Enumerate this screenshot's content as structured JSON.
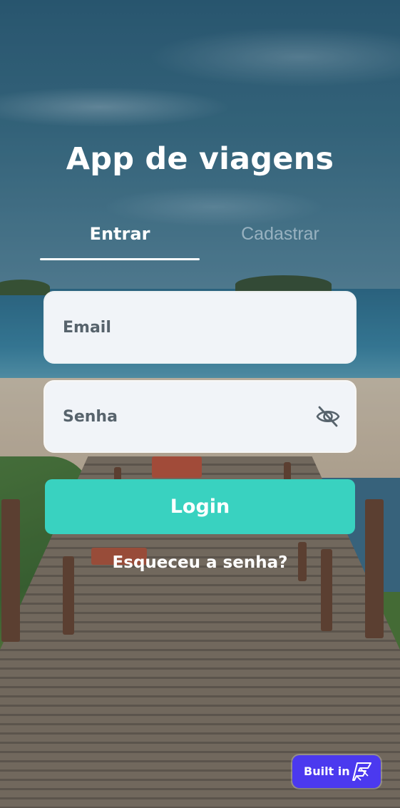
{
  "app": {
    "title": "App de viagens"
  },
  "tabs": [
    {
      "label": "Entrar",
      "active": true
    },
    {
      "label": "Cadastrar",
      "active": false
    }
  ],
  "form": {
    "email_placeholder": "Email",
    "email_value": "",
    "password_placeholder": "Senha",
    "password_value": "",
    "password_toggle_icon": "eye-off-icon",
    "login_label": "Login",
    "forgot_label": "Esqueceu a senha?"
  },
  "badge": {
    "label": "Built in",
    "icon": "flutterflow-icon"
  },
  "colors": {
    "accent": "#39d2c0",
    "badge": "#4b39ef",
    "field_bg": "#f1f4f8",
    "field_text": "#57636c",
    "tab_indicator": "#ffffff"
  }
}
